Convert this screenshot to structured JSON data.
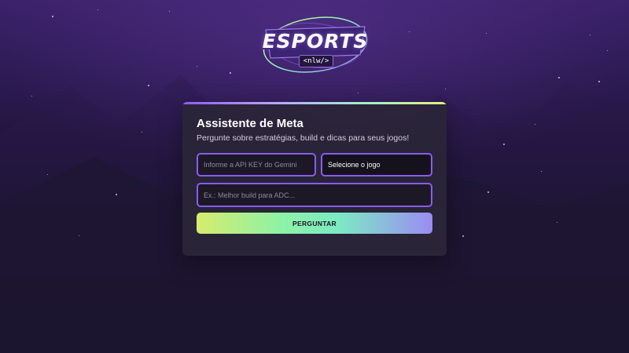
{
  "logo": {
    "word": "ESPORTS",
    "tag": "<nlw/>"
  },
  "card": {
    "title": "Assistente de Meta",
    "subtitle": "Pergunte sobre estratégias, build e dicas para seus jogos!"
  },
  "form": {
    "api_key_placeholder": "Informe a API KEY do Gemini",
    "game_select_value": "Selecione o jogo",
    "question_placeholder": "Ex.: Melhor build para ADC...",
    "submit_label": "PERGUNTAR"
  },
  "colors": {
    "accent": "#8a5cf0",
    "card_bg": "#2a2538",
    "button_gradient_start": "#d6ec6e",
    "button_gradient_mid": "#7ceac3",
    "button_gradient_end": "#9b8cf2"
  }
}
